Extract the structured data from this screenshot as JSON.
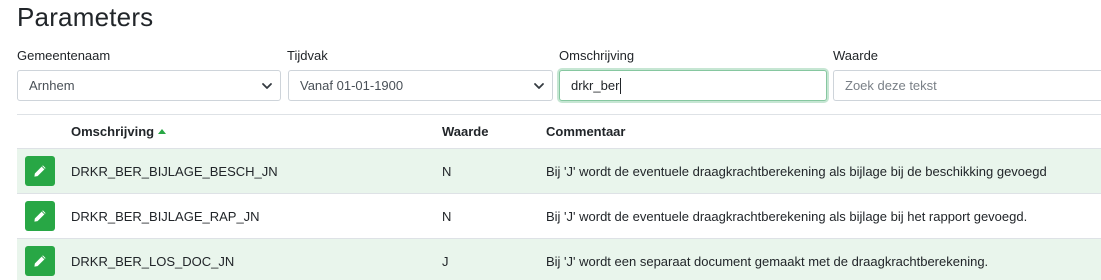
{
  "page": {
    "title": "Parameters"
  },
  "filters": {
    "gemeente": {
      "label": "Gemeentenaam",
      "value": "Arnhem"
    },
    "tijdvak": {
      "label": "Tijdvak",
      "value": "Vanaf 01-01-1900"
    },
    "omschrijving": {
      "label": "Omschrijving",
      "value": "drkr_ber"
    },
    "waarde": {
      "label": "Waarde",
      "placeholder": "Zoek deze tekst"
    }
  },
  "table": {
    "headers": {
      "omschrijving": "Omschrijving",
      "waarde": "Waarde",
      "commentaar": "Commentaar"
    },
    "sort": {
      "column": "omschrijving",
      "direction": "ascending"
    },
    "rows": [
      {
        "omschrijving": "DRKR_BER_BIJLAGE_BESCH_JN",
        "waarde": "N",
        "commentaar": "Bij 'J' wordt de eventuele draagkrachtberekening als bijlage bij de beschikking gevoegd"
      },
      {
        "omschrijving": "DRKR_BER_BIJLAGE_RAP_JN",
        "waarde": "N",
        "commentaar": "Bij 'J' wordt de eventuele draagkrachtberekening als bijlage bij het rapport gevoegd."
      },
      {
        "omschrijving": "DRKR_BER_LOS_DOC_JN",
        "waarde": "J",
        "commentaar": "Bij 'J' wordt een separaat document gemaakt met de draagkrachtberekening."
      }
    ]
  },
  "icons": {
    "edit": "pencil-icon",
    "select_caret": "chevron-down-icon",
    "sort": "sort-up-icon"
  },
  "colors": {
    "accent": "#28a745",
    "row_stripe": "#e9f5ec",
    "focus": "#86c7a0"
  }
}
